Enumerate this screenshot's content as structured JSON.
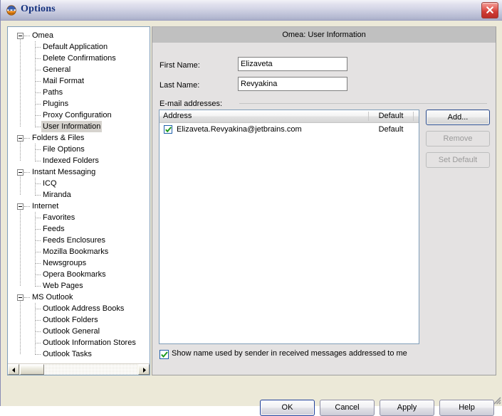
{
  "window": {
    "title": "Options",
    "icon": "omea-app-icon",
    "close_icon": "close-icon"
  },
  "tree": {
    "selected": "User Information",
    "nodes": [
      {
        "label": "Omea",
        "level": 0,
        "expanded": true
      },
      {
        "label": "Default Application",
        "level": 1
      },
      {
        "label": "Delete Confirmations",
        "level": 1
      },
      {
        "label": "General",
        "level": 1
      },
      {
        "label": "Mail Format",
        "level": 1
      },
      {
        "label": "Paths",
        "level": 1
      },
      {
        "label": "Plugins",
        "level": 1
      },
      {
        "label": "Proxy Configuration",
        "level": 1
      },
      {
        "label": "User Information",
        "level": 1
      },
      {
        "label": "Folders & Files",
        "level": 0,
        "expanded": true
      },
      {
        "label": "File Options",
        "level": 1
      },
      {
        "label": "Indexed Folders",
        "level": 1
      },
      {
        "label": "Instant Messaging",
        "level": 0,
        "expanded": true
      },
      {
        "label": "ICQ",
        "level": 1
      },
      {
        "label": "Miranda",
        "level": 1
      },
      {
        "label": "Internet",
        "level": 0,
        "expanded": true
      },
      {
        "label": "Favorites",
        "level": 1
      },
      {
        "label": "Feeds",
        "level": 1
      },
      {
        "label": "Feeds Enclosures",
        "level": 1
      },
      {
        "label": "Mozilla Bookmarks",
        "level": 1
      },
      {
        "label": "Newsgroups",
        "level": 1
      },
      {
        "label": "Opera Bookmarks",
        "level": 1
      },
      {
        "label": "Web Pages",
        "level": 1
      },
      {
        "label": "MS Outlook",
        "level": 0,
        "expanded": true
      },
      {
        "label": "Outlook Address Books",
        "level": 1
      },
      {
        "label": "Outlook Folders",
        "level": 1
      },
      {
        "label": "Outlook General",
        "level": 1
      },
      {
        "label": "Outlook Information Stores",
        "level": 1
      },
      {
        "label": "Outlook Tasks",
        "level": 1
      }
    ]
  },
  "panel": {
    "header": "Omea: User Information",
    "first_name_label": "First Name:",
    "first_name_value": "Elizaveta",
    "last_name_label": "Last Name:",
    "last_name_value": "Revyakina",
    "email_group_label": "E-mail addresses:",
    "list": {
      "columns": [
        "Address",
        "Default"
      ],
      "rows": [
        {
          "checked": true,
          "address": "Elizaveta.Revyakina@jetbrains.com",
          "default": "Default"
        }
      ]
    },
    "buttons": {
      "add": "Add...",
      "remove": "Remove",
      "set_default": "Set Default"
    },
    "show_name_label": "Show name used by sender in received messages addressed to me",
    "show_name_checked": true
  },
  "dialog_buttons": {
    "ok": "OK",
    "cancel": "Cancel",
    "apply": "Apply",
    "help": "Help"
  },
  "colors": {
    "title_text": "#15317e",
    "close_button": "#cf3c35",
    "selection": "#d6d3ce",
    "panel_header": "#c0c0c0",
    "check_green": "#1d9a1d",
    "focus_border": "#20409a"
  }
}
